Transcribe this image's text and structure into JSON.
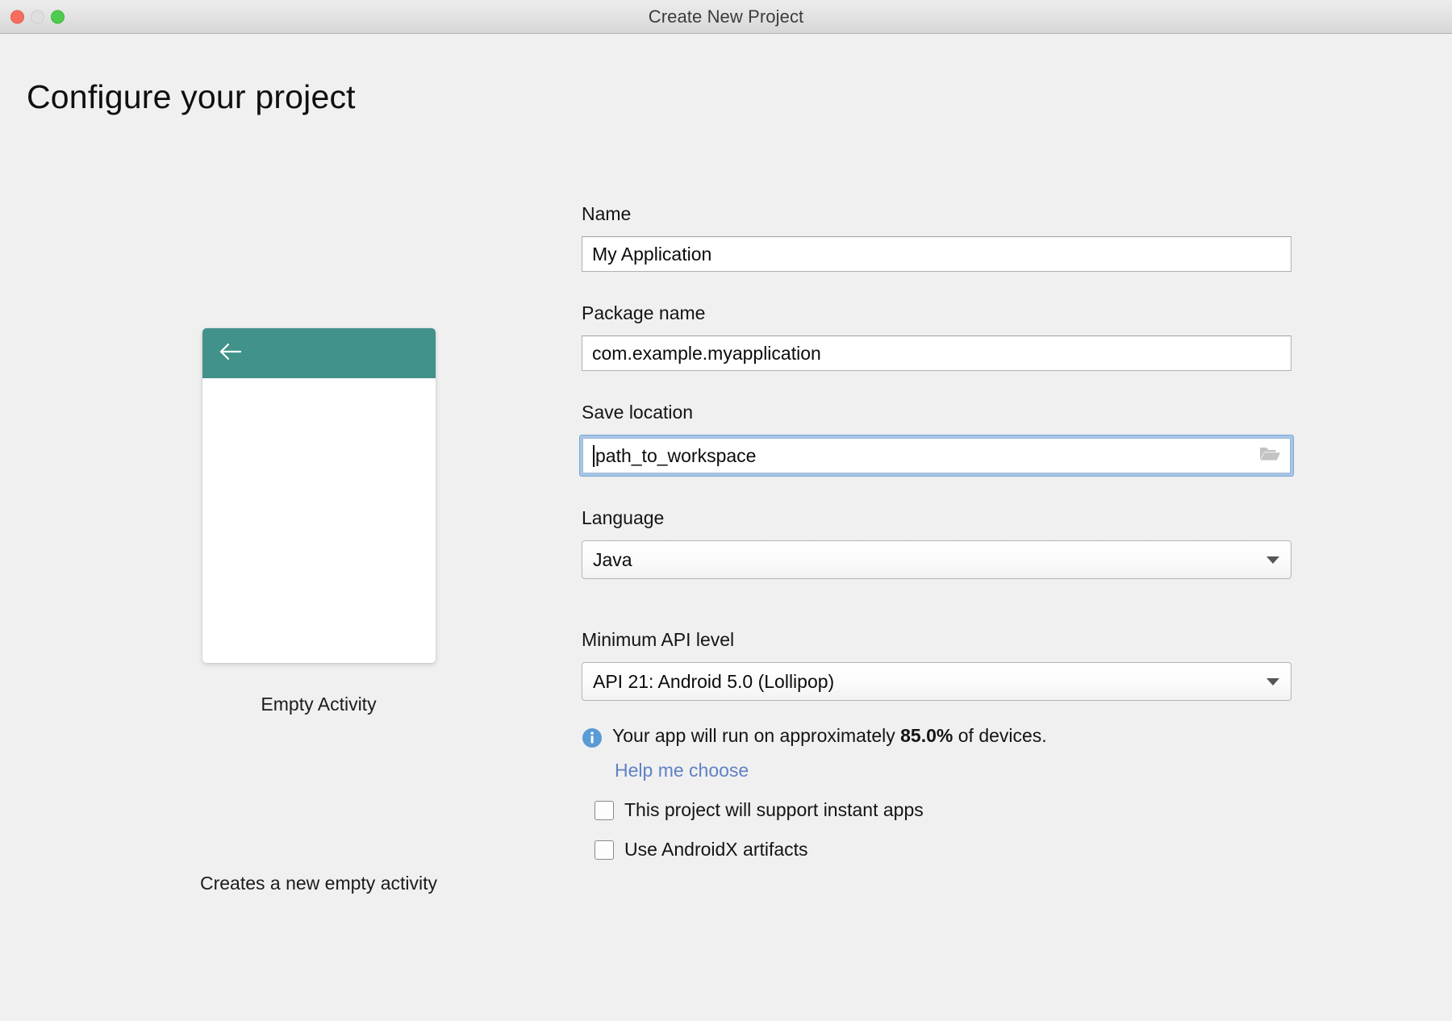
{
  "window": {
    "title": "Create New Project",
    "controls": {
      "close": "close-button",
      "minimize": "minimize-button",
      "maximize": "maximize-button"
    }
  },
  "page": {
    "heading": "Configure your project"
  },
  "preview": {
    "back_icon": "back-arrow-icon",
    "caption": "Empty Activity",
    "description": "Creates a new empty activity",
    "appbar_color": "#41928a"
  },
  "form": {
    "name": {
      "label": "Name",
      "value": "My Application"
    },
    "package_name": {
      "label": "Package name",
      "value": "com.example.myapplication"
    },
    "save_location": {
      "label": "Save location",
      "value": "path_to_workspace",
      "browse_icon": "folder-icon",
      "focused": true
    },
    "language": {
      "label": "Language",
      "value": "Java",
      "dropdown_icon": "chevron-down-icon"
    },
    "min_api": {
      "label": "Minimum API level",
      "value": "API 21: Android 5.0 (Lollipop)",
      "dropdown_icon": "chevron-down-icon"
    },
    "device_info": {
      "icon": "info-icon",
      "prefix": "Your app will run on approximately ",
      "percent": "85.0%",
      "suffix": " of devices.",
      "help_link": "Help me choose"
    },
    "checkboxes": [
      {
        "label": "This project will support instant apps",
        "checked": false
      },
      {
        "label": "Use AndroidX artifacts",
        "checked": false
      }
    ]
  },
  "colors": {
    "accent_teal": "#41928a",
    "link_blue": "#5f81c4",
    "info_blue": "#5b9bd5",
    "focus_ring": "#a7c6e8",
    "background": "#f0f0f0"
  }
}
